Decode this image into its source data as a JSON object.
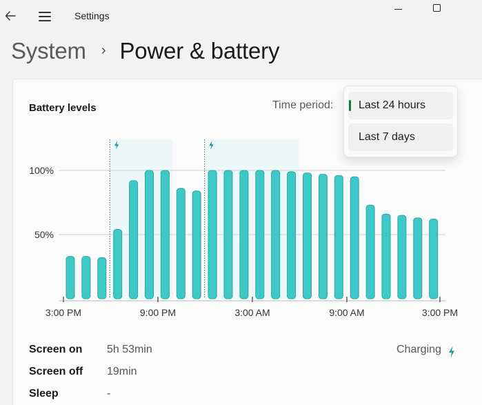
{
  "window": {
    "title": "Settings",
    "back_icon": "arrow-left-icon",
    "menu_icon": "hamburger-icon",
    "minimize_icon": "minimize-icon",
    "maximize_icon": "maximize-icon"
  },
  "breadcrumb": {
    "parent": "System",
    "separator": "›",
    "current": "Power & battery"
  },
  "battery_levels": {
    "title": "Battery levels",
    "time_period_label": "Time period:",
    "time_period_options": [
      "Last 24 hours",
      "Last 7 days"
    ],
    "selected_option": "Last 24 hours",
    "accent_color": "#0f7b3f"
  },
  "chart_data": {
    "type": "bar",
    "y_tick_labels": [
      "100%",
      "50%"
    ],
    "y_ticks": [
      100,
      50
    ],
    "ylim": [
      0,
      100
    ],
    "x_tick_labels": [
      "3:00 PM",
      "9:00 PM",
      "3:00 AM",
      "9:00 AM",
      "3:00 PM"
    ],
    "values": [
      33,
      33,
      32,
      54,
      92,
      100,
      100,
      86,
      84,
      100,
      100,
      100,
      100,
      100,
      99,
      98,
      97,
      96,
      95,
      73,
      66,
      65,
      63,
      62
    ],
    "charging_periods": [
      [
        3,
        6
      ],
      [
        9,
        14
      ]
    ],
    "bar_color": "#3fc9c6",
    "charging_band_color": "#edf8f8",
    "grid": true
  },
  "stats": [
    {
      "label": "Screen on",
      "value": "5h 53min"
    },
    {
      "label": "Screen off",
      "value": "19min"
    },
    {
      "label": "Sleep",
      "value": "-"
    }
  ],
  "legend": {
    "charging_label": "Charging",
    "charging_icon": "lightning-bolt-icon"
  }
}
